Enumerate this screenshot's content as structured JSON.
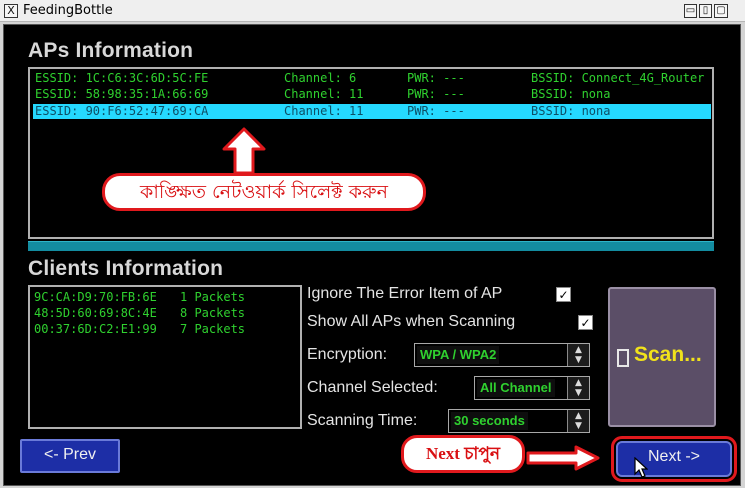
{
  "window": {
    "title": "FeedingBottle",
    "close_glyph": "X"
  },
  "aps": {
    "title": "APs Information",
    "rows": [
      {
        "essid": "ESSID: 1C:C6:3C:6D:5C:FE",
        "channel": "Channel: 6",
        "pwr": "PWR: ---",
        "bssid": "BSSID: Connect_4G_Router",
        "selected": false
      },
      {
        "essid": "ESSID: 58:98:35:1A:66:69",
        "channel": "Channel: 11",
        "pwr": "PWR: ---",
        "bssid": "BSSID: nona",
        "selected": false
      },
      {
        "essid": "ESSID: 90:F6:52:47:69:CA",
        "channel": "Channel: 11",
        "pwr": "PWR: ---",
        "bssid": "BSSID: nona",
        "selected": true
      }
    ]
  },
  "annotations": {
    "select_network": "কাঙ্ক্ষিত নেটওয়ার্ক সিলেক্ট করুন",
    "press_next": "Next চাপুন",
    "color": "#e0191d"
  },
  "clients": {
    "title": "Clients Information",
    "rows": [
      {
        "mac": "9C:CA:D9:70:FB:6E",
        "packets": "1 Packets"
      },
      {
        "mac": "48:5D:60:69:8C:4E",
        "packets": "8 Packets"
      },
      {
        "mac": "00:37:6D:C2:E1:99",
        "packets": "7 Packets"
      }
    ]
  },
  "options": {
    "ignore_error": {
      "label": "Ignore The Error Item of AP",
      "checked": true,
      "mark": "✓"
    },
    "show_all": {
      "label": "Show All APs when Scanning",
      "checked": true,
      "mark": "✓"
    },
    "encryption": {
      "label": "Encryption:",
      "value": "WPA / WPA2"
    },
    "channel": {
      "label": "Channel Selected:",
      "value": "All Channel"
    },
    "scan_time": {
      "label": "Scanning Time:",
      "value": "30 seconds"
    }
  },
  "buttons": {
    "scan": "Scan...",
    "prev": "<- Prev",
    "next": "Next ->"
  },
  "colors": {
    "list_text": "#2fd12f",
    "selection": "#25d9ff",
    "nav_button": "#1d2ea6",
    "scan_button": "#5b4e67",
    "scan_text": "#f1e21b"
  },
  "icons": {
    "spinner": "spin-updown-icon",
    "arrow_up": "arrow-up-icon",
    "arrow_right": "arrow-right-icon",
    "cursor": "mouse-cursor-icon"
  }
}
